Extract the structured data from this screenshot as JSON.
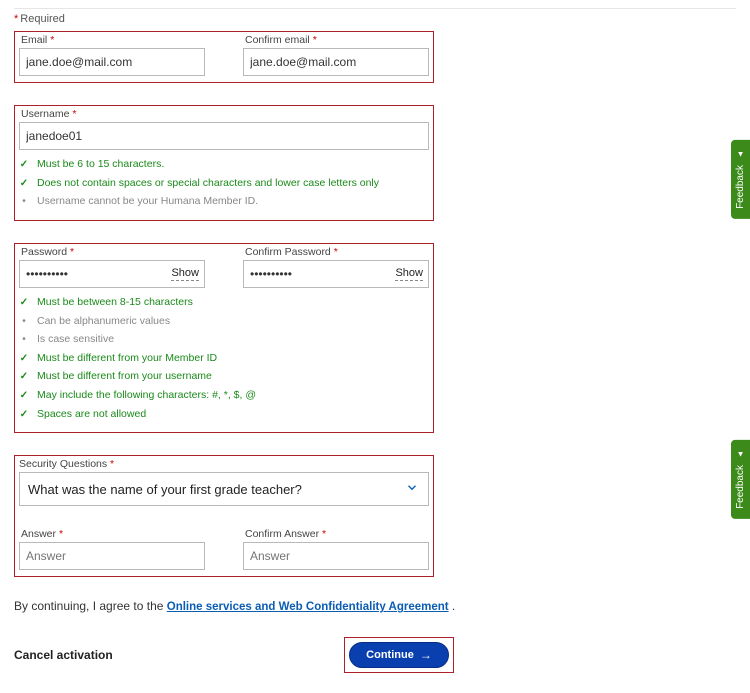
{
  "requiredNote": "Required",
  "email": {
    "label": "Email",
    "confirmLabel": "Confirm email",
    "value": "jane.doe@mail.com",
    "confirmValue": "jane.doe@mail.com"
  },
  "username": {
    "label": "Username",
    "value": "janedoe01",
    "rules": [
      {
        "text": "Must be 6 to 15 characters.",
        "met": true
      },
      {
        "text": "Does not contain spaces or special characters and lower case letters only",
        "met": true
      },
      {
        "text": "Username cannot be your Humana Member ID.",
        "met": false
      }
    ]
  },
  "password": {
    "label": "Password",
    "confirmLabel": "Confirm Password",
    "value": "••••••••••",
    "confirmValue": "••••••••••",
    "showLabel": "Show",
    "rules": [
      {
        "text": "Must be between 8-15 characters",
        "met": true
      },
      {
        "text": "Can be alphanumeric values",
        "met": false
      },
      {
        "text": "Is case sensitive",
        "met": false
      },
      {
        "text": "Must be different from your Member ID",
        "met": true
      },
      {
        "text": "Must be different from your username",
        "met": true
      },
      {
        "text": "May include the following characters: #, *, $, @",
        "met": true
      },
      {
        "text": "Spaces are not allowed",
        "met": true
      }
    ]
  },
  "security": {
    "label": "Security Questions",
    "selected": "What was the name of your first grade teacher?",
    "answerLabel": "Answer",
    "confirmAnswerLabel": "Confirm Answer",
    "answerPlaceholder": "Answer"
  },
  "agree": {
    "prefix": "By continuing, I agree to the ",
    "linkText": "Online services and Web Confidentiality Agreement",
    "suffix": " ."
  },
  "actions": {
    "cancel": "Cancel activation",
    "continue": "Continue"
  },
  "feedback": "Feedback"
}
